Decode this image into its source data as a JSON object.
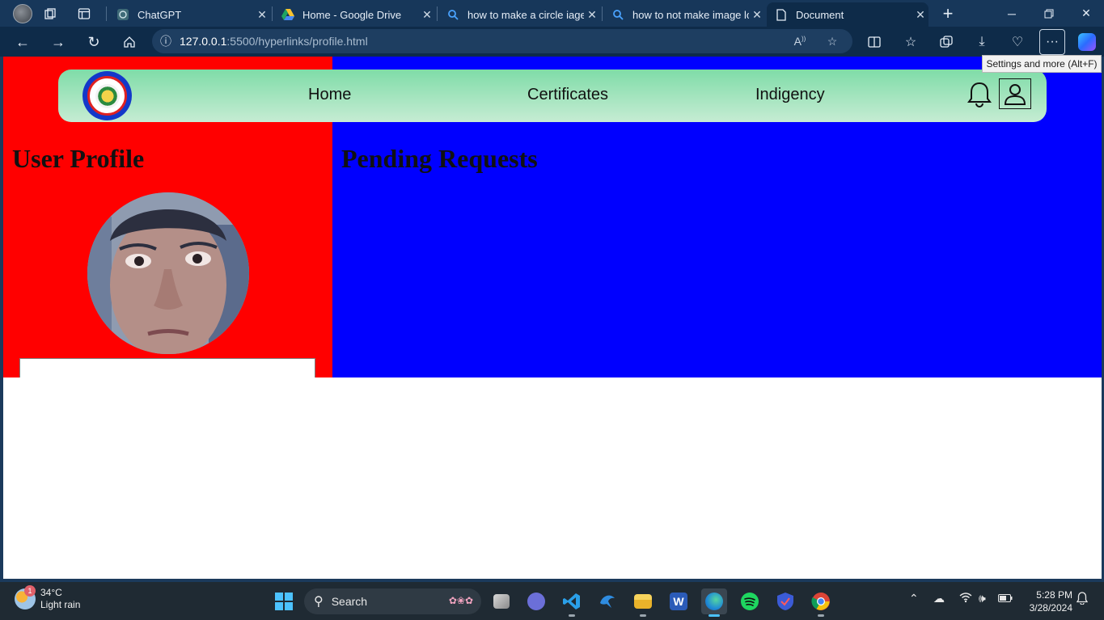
{
  "browser": {
    "tabs": [
      {
        "title": "ChatGPT",
        "icon": "chatgpt-icon"
      },
      {
        "title": "Home - Google Drive",
        "icon": "drive-icon"
      },
      {
        "title": "how to make a circle iage",
        "icon": "search-icon"
      },
      {
        "title": "how to not make image lo",
        "icon": "search-icon"
      },
      {
        "title": "Document",
        "icon": "page-icon"
      }
    ],
    "url_host": "127.0.0.1",
    "url_path": ":5500/hyperlinks/profile.html",
    "tooltip": "Settings and more (Alt+F)"
  },
  "page": {
    "nav": {
      "links": [
        "Home",
        "Certificates",
        "Indigency"
      ]
    },
    "left_heading": "User Profile",
    "right_heading": "Pending Requests",
    "name_field_value": "",
    "colors": {
      "left_panel": "#ff0000",
      "right_panel": "#0000ff",
      "nav_top": "#7fdca8",
      "nav_bottom": "#c6ecd3"
    }
  },
  "taskbar": {
    "weather_temp": "34°C",
    "weather_desc": "Light rain",
    "weather_badge": "1",
    "search_label": "Search",
    "time": "5:28 PM",
    "date": "3/28/2024"
  }
}
